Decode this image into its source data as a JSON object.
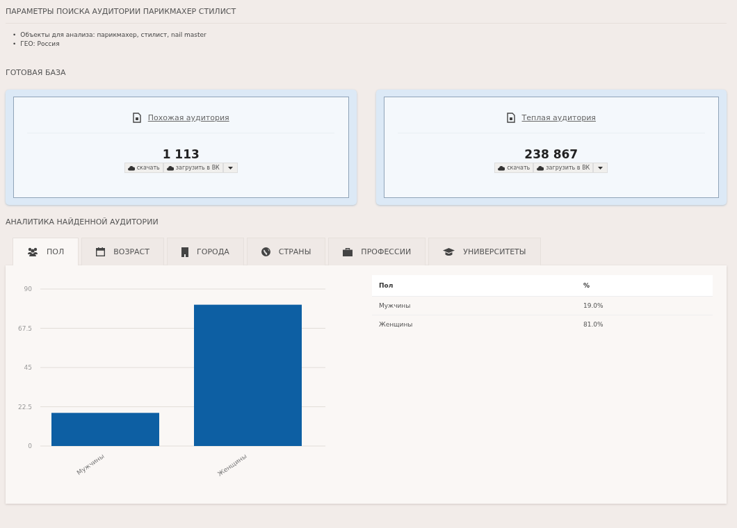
{
  "title": "ПАРАМЕТРЫ ПОИСКА АУДИТОРИИ ПАРИКМАХЕР СТИЛИСТ",
  "params": [
    {
      "marker": "•",
      "text": "Объекты для анализа: парикмахер, стилист, nail master"
    },
    {
      "marker": "•",
      "text": "ГЕО: Россия"
    }
  ],
  "base_title": "ГОТОВАЯ БАЗА",
  "cards": [
    {
      "link": "Похожая аудитория",
      "count": "1 113",
      "download": "скачать",
      "upload": "загрузить в ВК"
    },
    {
      "link": "Теплая аудитория",
      "count": "238 867",
      "download": "скачать",
      "upload": "загрузить в ВК"
    }
  ],
  "analytics_title": "АНАЛИТИКА НАЙДЕННОЙ АУДИТОРИИ",
  "tabs": [
    {
      "label": "ПОЛ",
      "selected": true
    },
    {
      "label": "ВОЗРАСТ",
      "selected": false
    },
    {
      "label": "ГОРОДА",
      "selected": false
    },
    {
      "label": "СТРАНЫ",
      "selected": false
    },
    {
      "label": "ПРОФЕССИИ",
      "selected": false
    },
    {
      "label": "УНИВЕРСИТЕТЫ",
      "selected": false
    }
  ],
  "chart_data": {
    "type": "bar",
    "categories": [
      "Мужчины",
      "Женщины"
    ],
    "series": [
      {
        "color": "#0d5fa3",
        "values": [
          19,
          81
        ]
      }
    ],
    "grid": true,
    "ylim": [
      0,
      90
    ],
    "yticks": [
      0,
      22.5,
      45,
      67.5,
      90
    ]
  },
  "table": {
    "columns": [
      "Пол",
      "%"
    ],
    "rows": [
      [
        "Мужчины",
        "19.0%"
      ],
      [
        "Женщины",
        "81.0%"
      ]
    ]
  }
}
